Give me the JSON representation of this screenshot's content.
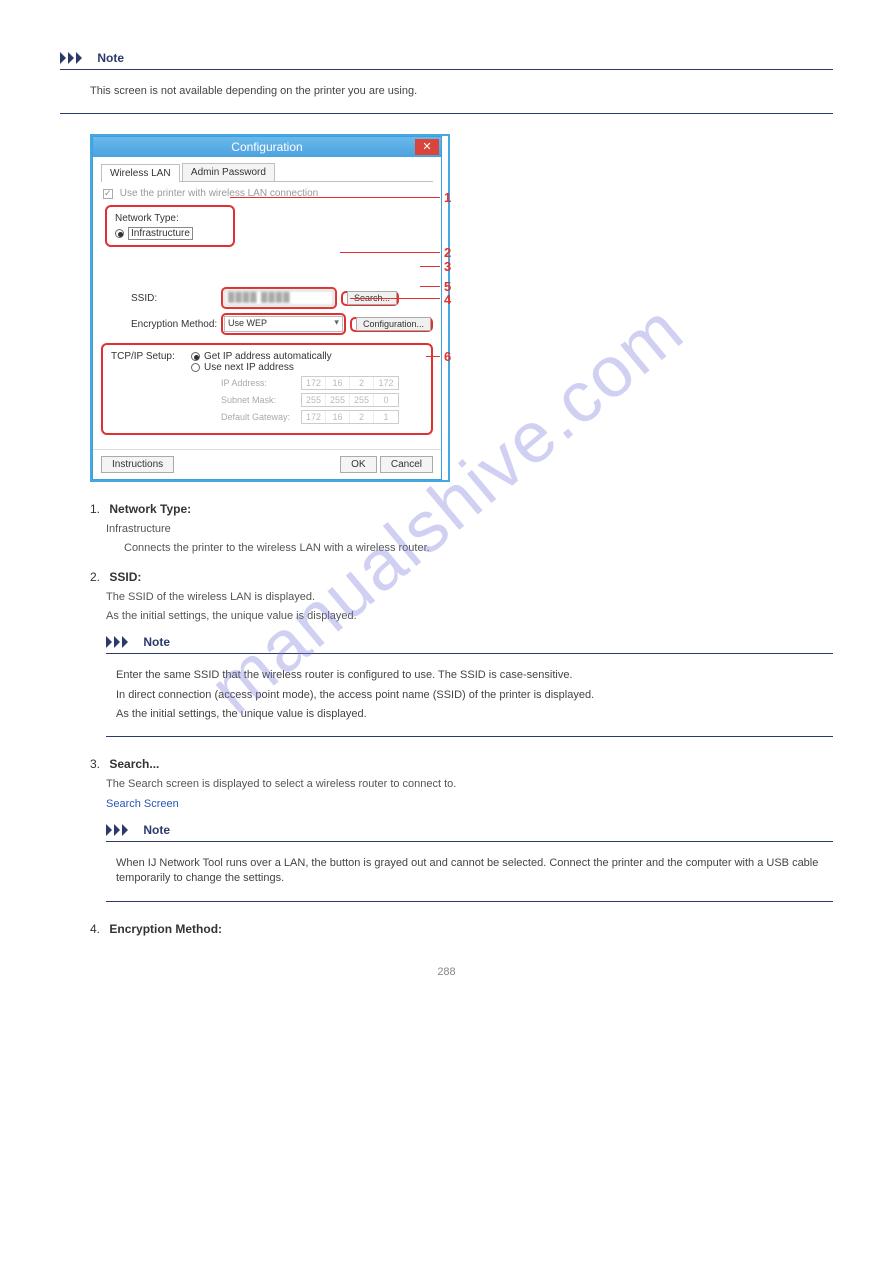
{
  "watermark": "manualshive.com",
  "note": {
    "heading": "Note",
    "body": "This screen is not available depending on the printer you are using."
  },
  "dialog": {
    "title": "Configuration",
    "tabs": {
      "wireless": "Wireless LAN",
      "admin": "Admin Password"
    },
    "checkbox": "Use the printer with wireless LAN connection",
    "network_type_label": "Network Type:",
    "infrastructure_label": "Infrastructure",
    "ssid_label": "SSID:",
    "ssid_value": "████  ████",
    "search_btn": "Search...",
    "enc_label": "Encryption Method:",
    "enc_value": "Use WEP",
    "config_btn": "Configuration...",
    "tcpip_label": "TCP/IP Setup:",
    "auto_label": "Get IP address automatically",
    "next_label": "Use next IP address",
    "ip_label": "IP Address:",
    "ip": [
      "172",
      "16",
      "2",
      "172"
    ],
    "mask_label": "Subnet Mask:",
    "mask": [
      "255",
      "255",
      "255",
      "0"
    ],
    "gw_label": "Default Gateway:",
    "gw": [
      "172",
      "16",
      "2",
      "1"
    ],
    "instructions_btn": "Instructions",
    "ok_btn": "OK",
    "cancel_btn": "Cancel"
  },
  "callouts": [
    "1",
    "2",
    "3",
    "4",
    "5",
    "6"
  ],
  "items": {
    "i1": {
      "num": "1.",
      "title": "Network Type:",
      "desc_label": "Infrastructure",
      "desc": "Connects the printer to the wireless LAN with a wireless router."
    },
    "i2": {
      "num": "2.",
      "title": "SSID:",
      "desc": "The SSID of the wireless LAN is displayed.",
      "desc2": "As the initial settings, the unique value is displayed."
    },
    "i2note": {
      "heading": "Note",
      "l1": "Enter the same SSID that the wireless router is configured to use. The SSID is case-sensitive.",
      "l2": "In direct connection (access point mode), the access point name (SSID) of the printer is displayed.",
      "l3": "As the initial settings, the unique value is displayed."
    },
    "i3": {
      "num": "3.",
      "title": "Search...",
      "desc": "The Search screen is displayed to select a wireless router to connect to.",
      "link": "Search Screen"
    },
    "i3note": {
      "heading": "Note",
      "l1": "When IJ Network Tool runs over a LAN, the button is grayed out and cannot be selected. Connect the printer and the computer with a USB cable temporarily to change the settings."
    },
    "i4": {
      "num": "4.",
      "title": "Encryption Method:"
    }
  },
  "page_number": "288"
}
